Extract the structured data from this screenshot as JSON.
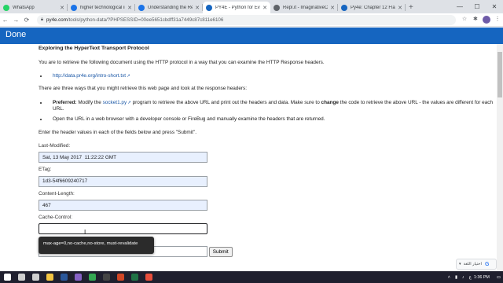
{
  "browser": {
    "tabs": [
      {
        "title": "WhatsApp",
        "favicon_color": "#25d366",
        "active": false
      },
      {
        "title": "higher technological in",
        "favicon_color": "#1a73e8",
        "active": false
      },
      {
        "title": "Understanding the Req",
        "favicon_color": "#1a73e8",
        "active": false
      },
      {
        "title": "PY4E - Python for Every",
        "favicon_color": "#1565c0",
        "active": true
      },
      {
        "title": "Repl.it - ImaginativeCl",
        "favicon_color": "#5f6368",
        "active": false
      },
      {
        "title": "Py4e: Chapter 12 Flash",
        "favicon_color": "#1565c0",
        "active": false
      }
    ],
    "new_tab": "+",
    "window_controls": {
      "minimize": "—",
      "maximize": "☐",
      "close": "✕"
    },
    "address": {
      "domain": "py4e.com",
      "path": "/tools/python-data/?PHPSESSID=00ee5651cbdff31a7449c87c811e6106"
    }
  },
  "header": {
    "done_label": "Done",
    "color": "#1565c0"
  },
  "page": {
    "title": "Exploring the HyperText Transport Protocol",
    "intro": "You are to retrieve the following document using the HTTP protocol in a way that you can examine the HTTP Response headers.",
    "doc_link": "http://data.pr4e.org/intro-short.txt",
    "ways_intro": "There are three ways that you might retrieve this web page and look at the response headers:",
    "bullet1_label": "Preferred:",
    "bullet1_pre": " Modify the ",
    "bullet1_link": "socket1.py",
    "bullet1_mid": " program to retrieve the above URL and print out the headers and data. Make sure to ",
    "bullet1_bold": "change",
    "bullet1_post": " the code to retrieve the above URL - the values are different for each URL.",
    "bullet2": "Open the URL in a web browser with a developer console or FireBug and manually examine the headers that are returned.",
    "instructions": "Enter the header values in each of the fields below and press \"Submit\".",
    "fields": [
      {
        "label": "Last-Modified:",
        "value": "Sat, 13 May 2017  11:22:22 GMT"
      },
      {
        "label": "ETag:",
        "value": "1d3-54f6609240717"
      },
      {
        "label": "Content-Length:",
        "value": "467"
      },
      {
        "label": "Cache-Control:",
        "value": ""
      }
    ],
    "autocomplete_suggestion": "max-age=0,no-cache,no-store, must-revalidate",
    "submit_label": "Submit"
  },
  "translate_chip": {
    "text": "اختيار اللغة",
    "brand": "G"
  },
  "taskbar": {
    "icons": [
      {
        "name": "windows-start-icon",
        "color": "#ffffff"
      },
      {
        "name": "search-icon",
        "color": "#cfcfcf"
      },
      {
        "name": "task-view-icon",
        "color": "#cfcfcf"
      },
      {
        "name": "file-explorer-icon",
        "color": "#f4c542"
      },
      {
        "name": "word-icon",
        "color": "#2b579a"
      },
      {
        "name": "visual-studio-icon",
        "color": "#8661c5"
      },
      {
        "name": "chrome-icon",
        "color": "#34a853"
      },
      {
        "name": "terminal-icon",
        "color": "#444444"
      },
      {
        "name": "powerpoint-icon",
        "color": "#d24726"
      },
      {
        "name": "excel-icon",
        "color": "#217346"
      },
      {
        "name": "app-icon",
        "color": "#e94e3c"
      }
    ],
    "time": "1:36 PM",
    "date": "",
    "lang": "ع"
  }
}
